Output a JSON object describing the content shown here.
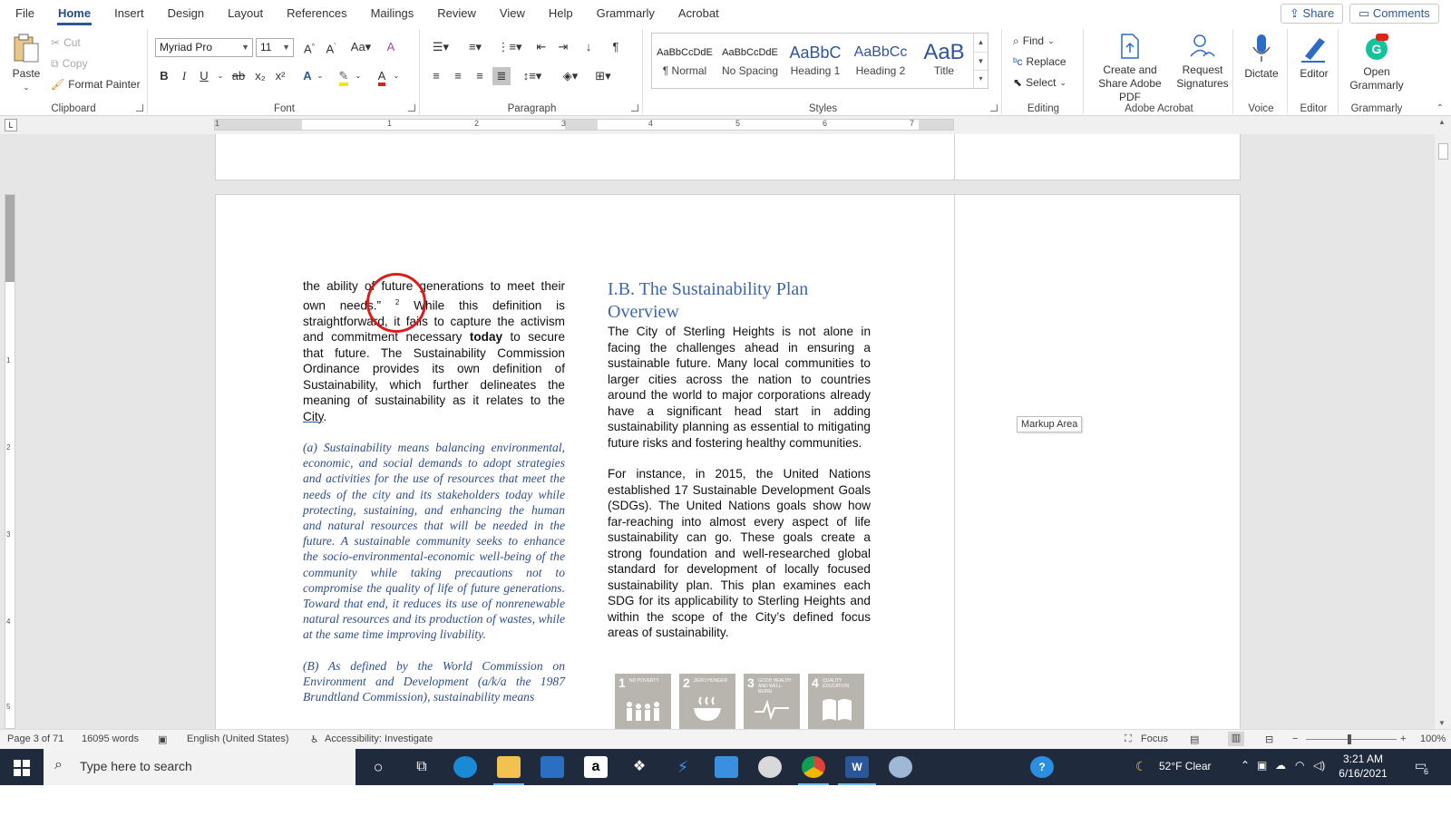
{
  "menu": {
    "tabs": [
      "File",
      "Home",
      "Insert",
      "Design",
      "Layout",
      "References",
      "Mailings",
      "Review",
      "View",
      "Help",
      "Grammarly",
      "Acrobat"
    ],
    "active_tab": "Home",
    "share": "Share",
    "comments": "Comments"
  },
  "ribbon": {
    "clipboard": {
      "paste": "Paste",
      "cut": "Cut",
      "copy": "Copy",
      "format_painter": "Format Painter",
      "label": "Clipboard"
    },
    "font": {
      "name": "Myriad Pro",
      "size": "11",
      "label": "Font",
      "buttons": [
        "B",
        "I",
        "U",
        "ab",
        "x₂",
        "x²"
      ]
    },
    "paragraph": {
      "label": "Paragraph"
    },
    "styles": {
      "label": "Styles",
      "items": [
        {
          "sample": "AaBbCcDdE",
          "name": "¶ Normal"
        },
        {
          "sample": "AaBbCcDdE",
          "name": "No Spacing"
        },
        {
          "sample": "AaBbC",
          "name": "Heading 1"
        },
        {
          "sample": "AaBbCc",
          "name": "Heading 2"
        },
        {
          "sample": "AaB",
          "name": "Title"
        }
      ]
    },
    "editing": {
      "find": "Find",
      "replace": "Replace",
      "select": "Select",
      "label": "Editing"
    },
    "acrobat": {
      "create_share": "Create and Share Adobe PDF",
      "request_sig": "Request Signatures",
      "label": "Adobe Acrobat"
    },
    "voice": {
      "dictate": "Dictate",
      "label": "Voice"
    },
    "editor": {
      "editor": "Editor",
      "label": "Editor"
    },
    "grammarly": {
      "open": "Open Grammarly",
      "label": "Grammarly"
    }
  },
  "ruler": {
    "numbers": [
      "1",
      "1",
      "2",
      "3",
      "4",
      "5",
      "6",
      "7"
    ]
  },
  "vruler": {
    "numbers": [
      "1",
      "2",
      "3",
      "4",
      "5"
    ]
  },
  "document": {
    "left_para_1a": "the ability of future generations to meet their own needs.”",
    "footnote": "2",
    "left_para_1b": "While this definition is straightforward, it fails to capture the activism and commitment necessary",
    "left_bold": "today",
    "left_para_1c": "to secure that future. The Sustainability Commission Ordinance provides its own definition of Sustainability, which further delineates the meaning of sustainability as it relates to the",
    "left_city": "City",
    "left_period": ".",
    "quote_a": "(a) Sustainability means balancing environmental, economic, and social demands to adopt strategies and activities for the use of resources that meet the needs of the city and its stakeholders today while protecting, sustaining, and enhancing the human and natural resources that will be needed in the future. A sustainable community seeks to enhance the socio-environmental-economic well-being of the community while taking precautions not to compromise the quality of life of future generations. Toward that end, it reduces its use of nonrenewable natural resources and its production of wastes, while at the same time improving livability.",
    "quote_b": "(B) As defined by the World Commission on Environment and Development (a/k/a the 1987 Brundtland Commission), sustainability means",
    "heading": "I.B. The Sustainability Plan Overview",
    "right_para_1": "The City of Sterling Heights is not alone in facing the challenges ahead in ensuring a sustainable future. Many local communities to larger cities across the nation to countries around the world to major corporations already have a significant head start in adding sustainability planning as essential to mitigating future risks and fostering healthy communities.",
    "right_para_2": "For instance, in 2015, the United Nations established 17 Sustainable Development Goals (SDGs). The United Nations goals show how far-reaching into almost every aspect of life sustainability can go. These goals create a strong foundation and well-researched global standard for development of locally focused sustainability plan. This plan examines each SDG for its applicability to Sterling Heights and within the scope of the City’s defined focus areas of sustainability.",
    "sdgs": [
      {
        "n": "1",
        "t": "NO POVERTY"
      },
      {
        "n": "2",
        "t": "ZERO HUNGER"
      },
      {
        "n": "3",
        "t": "GOOD HEALTH AND WELL-BEING"
      },
      {
        "n": "4",
        "t": "QUALITY EDUCATION"
      }
    ],
    "markup_area": "Markup Area"
  },
  "status": {
    "page": "Page 3 of 71",
    "words": "16095 words",
    "language": "English (United States)",
    "accessibility": "Accessibility: Investigate",
    "focus": "Focus",
    "zoom": "100%"
  },
  "taskbar": {
    "search_placeholder": "Type here to search",
    "weather": "52°F Clear",
    "time": "3:21 AM",
    "date": "6/16/2021",
    "notif_count": "6"
  }
}
